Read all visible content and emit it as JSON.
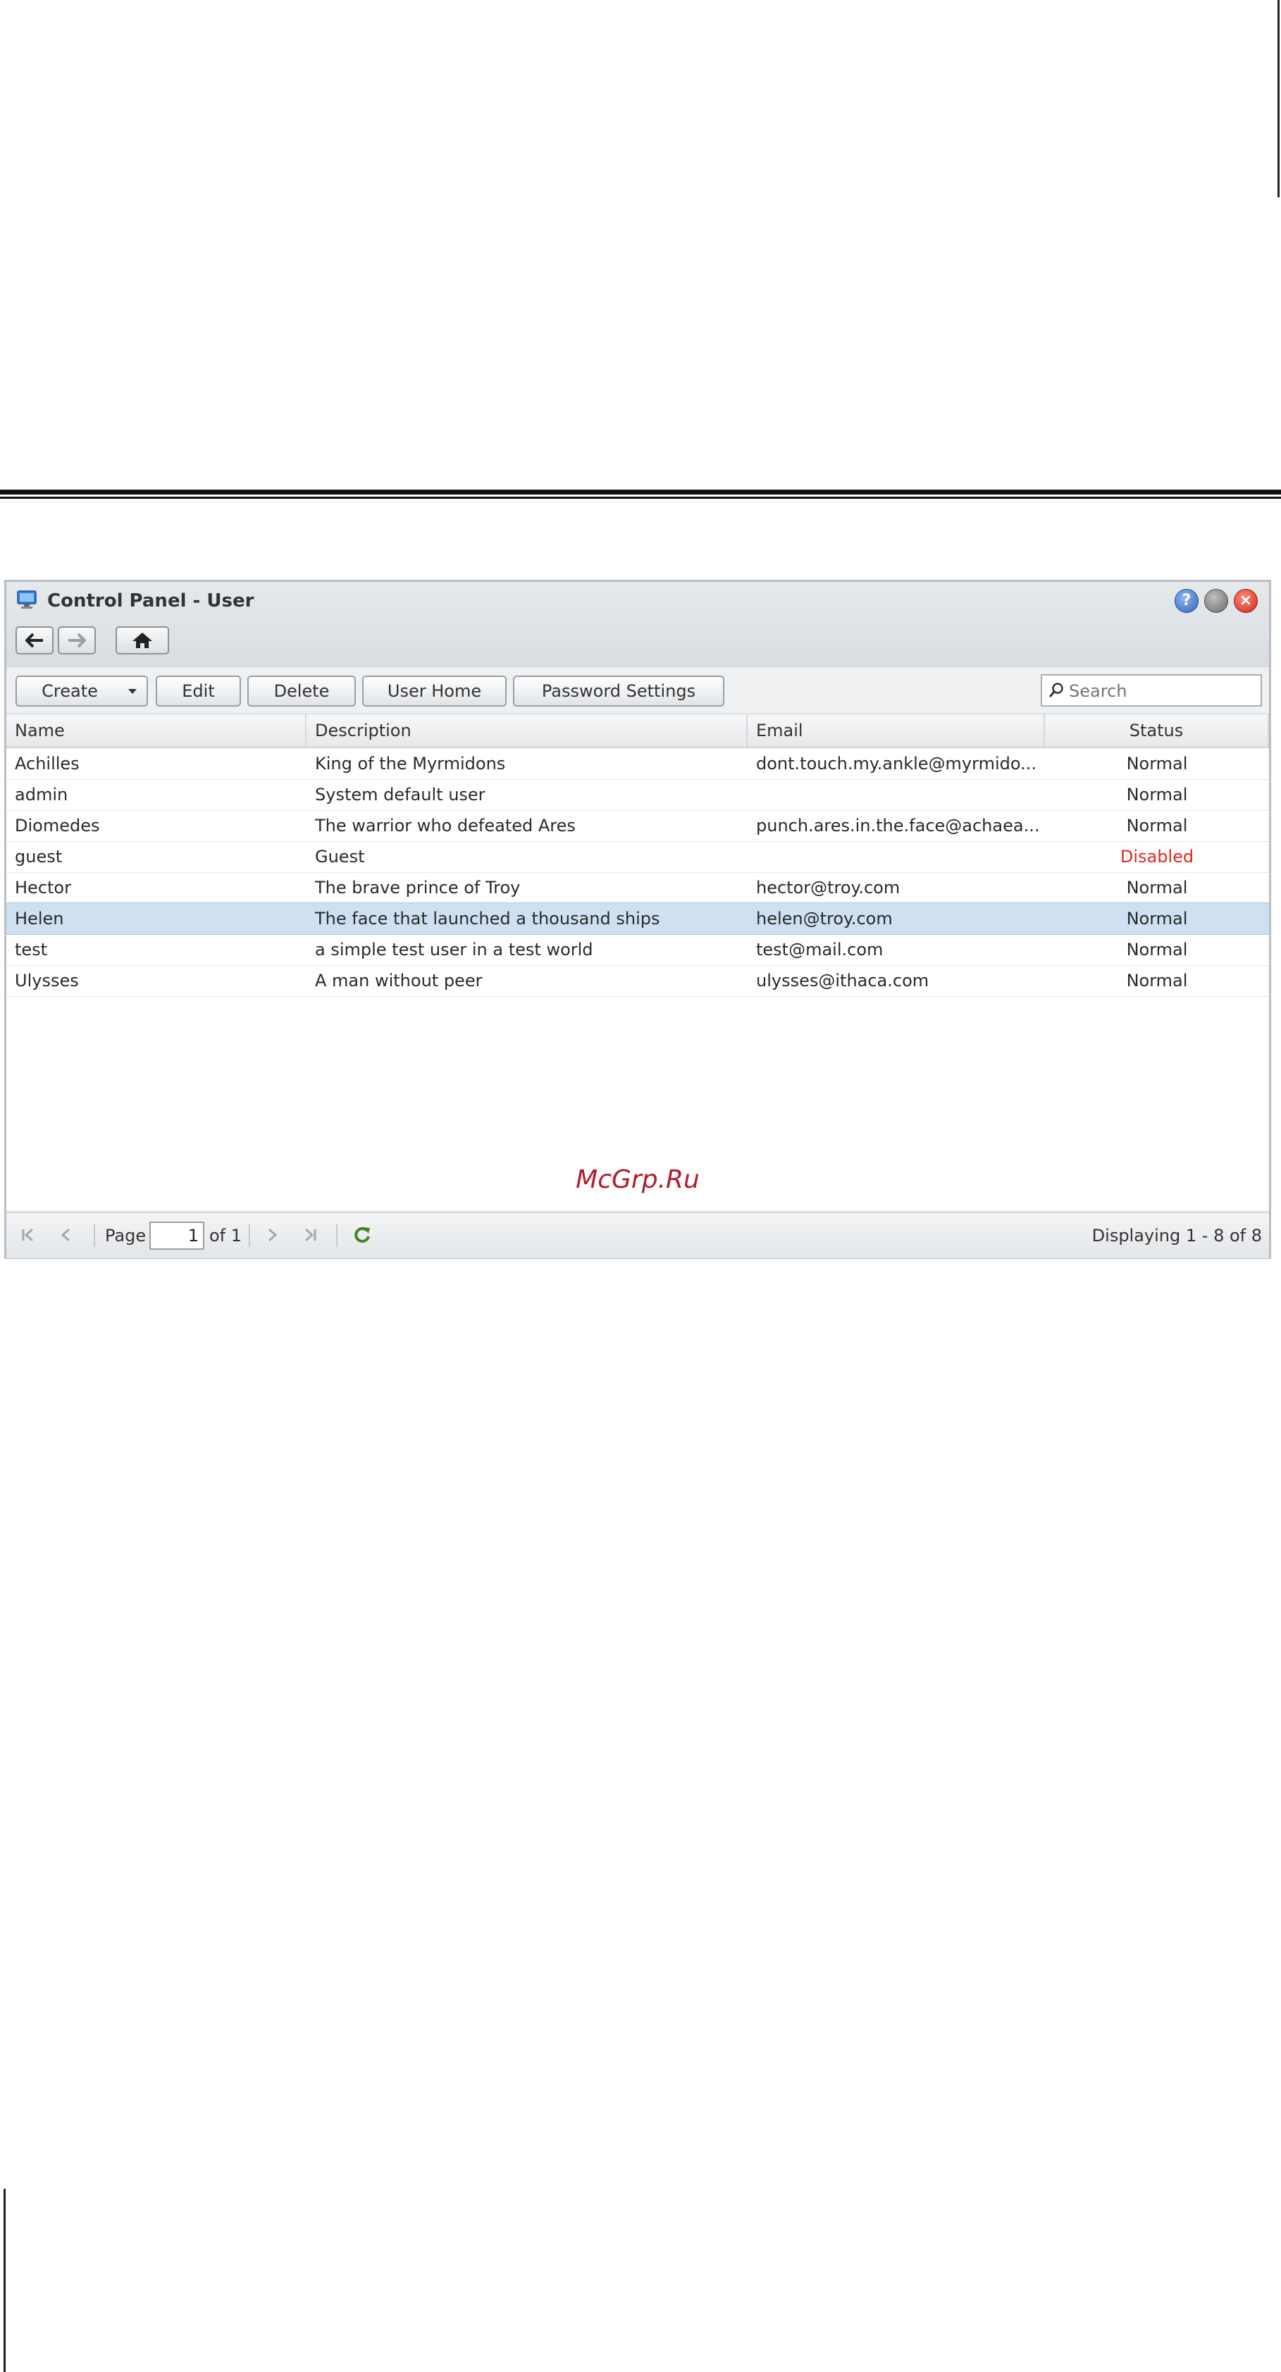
{
  "window": {
    "title": "Control Panel - User",
    "help_icon": "question-icon",
    "minimize_icon": "minimize-icon",
    "close_icon": "close-icon"
  },
  "nav": {
    "back_icon": "arrow-left-icon",
    "forward_icon": "arrow-right-icon",
    "home_icon": "home-icon"
  },
  "toolbar": {
    "create_label": "Create",
    "edit_label": "Edit",
    "delete_label": "Delete",
    "user_home_label": "User Home",
    "password_settings_label": "Password Settings",
    "search_placeholder": "Search"
  },
  "table": {
    "columns": [
      "Name",
      "Description",
      "Email",
      "Status"
    ],
    "rows": [
      {
        "name": "Achilles",
        "description": "King of the Myrmidons",
        "email": "dont.touch.my.ankle@myrmido...",
        "status": "Normal"
      },
      {
        "name": "admin",
        "description": "System default user",
        "email": "",
        "status": "Normal"
      },
      {
        "name": "Diomedes",
        "description": "The warrior who defeated Ares",
        "email": "punch.ares.in.the.face@achaea...",
        "status": "Normal"
      },
      {
        "name": "guest",
        "description": "Guest",
        "email": "",
        "status": "Disabled"
      },
      {
        "name": "Hector",
        "description": "The brave prince of Troy",
        "email": "hector@troy.com",
        "status": "Normal"
      },
      {
        "name": "Helen",
        "description": "The face that launched a thousand ships",
        "email": "helen@troy.com",
        "status": "Normal"
      },
      {
        "name": "test",
        "description": "a simple test user in a test world",
        "email": "test@mail.com",
        "status": "Normal"
      },
      {
        "name": "Ulysses",
        "description": "A man without peer",
        "email": "ulysses@ithaca.com",
        "status": "Normal"
      }
    ],
    "selected_row": "Helen"
  },
  "watermark": "McGrp.Ru",
  "pager": {
    "page_label": "Page",
    "page_value": "1",
    "of_label": "of 1",
    "displaying": "Displaying 1 - 8 of 8",
    "refresh_color": "#3b8a1f"
  },
  "colors": {
    "disabled_status": "#e0271f",
    "selected_row": "#cfe0f3"
  }
}
